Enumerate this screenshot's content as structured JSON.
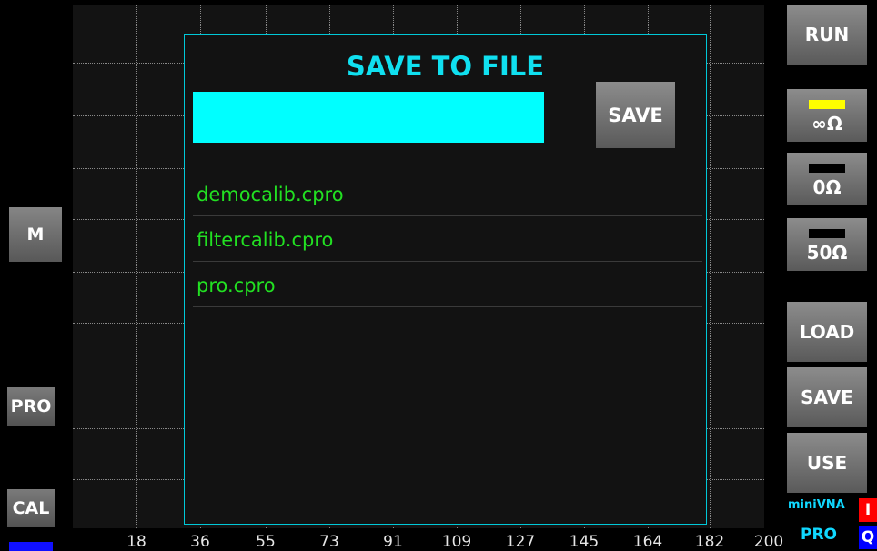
{
  "left_buttons": {
    "m": "M",
    "pro": "PRO",
    "cal": "CAL"
  },
  "right_buttons": {
    "run": "RUN",
    "open": "∞Ω",
    "short": "0Ω",
    "load_50": "50Ω",
    "load": "LOAD",
    "save": "SAVE",
    "use": "USE"
  },
  "brand": {
    "line1": "miniVNA",
    "line2": "PRO",
    "i": "I",
    "q": "Q"
  },
  "x_axis_ticks": [
    "18",
    "36",
    "55",
    "73",
    "91",
    "109",
    "127",
    "145",
    "164",
    "182",
    "200"
  ],
  "dialog": {
    "title": "SAVE TO FILE",
    "filename_value": "",
    "save_label": "SAVE",
    "files": [
      "democalib.cpro",
      "filtercalib.cpro",
      "pro.cpro"
    ]
  },
  "colors": {
    "dialog_border": "#00c8d8",
    "title": "#10e0f0",
    "input_bg": "#00ffff",
    "file_text": "#22e022",
    "open_indicator": "#ffff00",
    "i_badge": "#ff0000",
    "q_badge": "#0000ff"
  }
}
